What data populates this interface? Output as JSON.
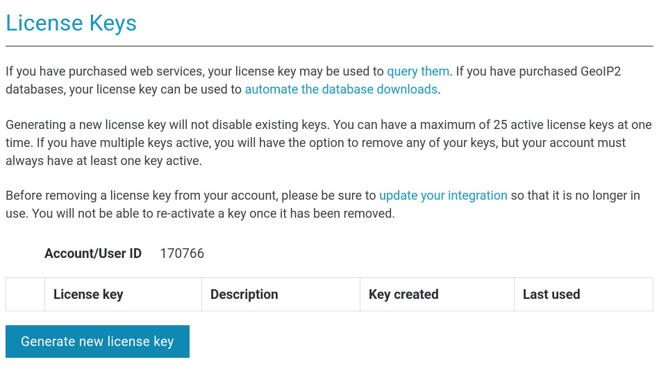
{
  "page_title": "License Keys",
  "intro": {
    "p1_a": "If you have purchased web services, your license key may be used to ",
    "p1_link1": "query them",
    "p1_b": ". If you have purchased GeoIP2 databases, your license key can be used to ",
    "p1_link2": "automate the database downloads",
    "p1_c": ".",
    "p2": "Generating a new license key will not disable existing keys. You can have a maximum of 25 active license keys at one time. If you have multiple keys active, you will have the option to remove any of your keys, but your account must always have at least one key active.",
    "p3_a": "Before removing a license key from your account, please be sure to ",
    "p3_link": "update your integration",
    "p3_b": " so that it is no longer in use. You will not be able to re-activate a key once it has been removed."
  },
  "account": {
    "label": "Account/User ID",
    "value": "170766"
  },
  "table": {
    "headers": {
      "blank": "",
      "license_key": "License key",
      "description": "Description",
      "key_created": "Key created",
      "last_used": "Last used"
    }
  },
  "button": {
    "generate": "Generate new license key"
  }
}
